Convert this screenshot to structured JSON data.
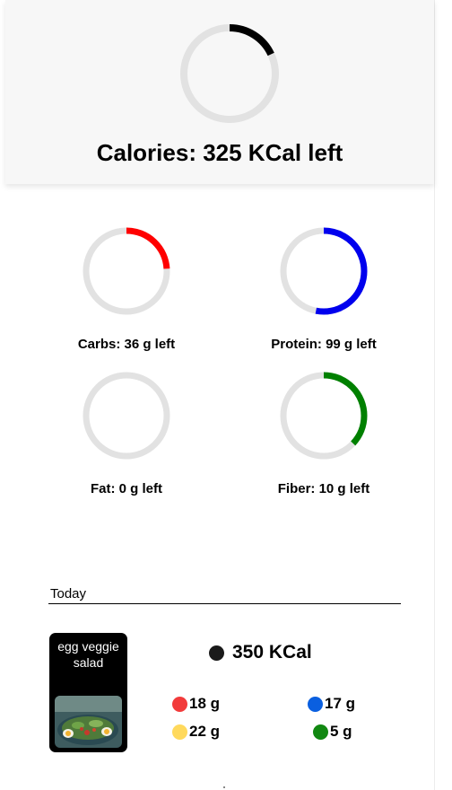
{
  "calories": {
    "label": "Calories: 325 KCal left",
    "progress": 0.18,
    "color": "#000000"
  },
  "macros": [
    {
      "id": "carbs",
      "label": "Carbs: 36 g left",
      "progress": 0.24,
      "color": "#ff0000"
    },
    {
      "id": "protein",
      "label": "Protein: 99 g left",
      "progress": 0.53,
      "color": "#0000ee"
    },
    {
      "id": "fat",
      "label": "Fat: 0 g left",
      "progress": 0.0,
      "color": "#ff0000"
    },
    {
      "id": "fiber",
      "label": "Fiber: 10 g left",
      "progress": 0.37,
      "color": "#008000"
    }
  ],
  "ring_track_color": "#e2e2e2",
  "today": {
    "label": "Today"
  },
  "meal": {
    "name": "egg veggie salad",
    "kcal": "350 KCal",
    "kcal_dot_color": "#1a1a1a",
    "nutrients": [
      {
        "id": "carbs",
        "value": "18 g",
        "color": "#f23b3b"
      },
      {
        "id": "protein",
        "value": "17 g",
        "color": "#0a5fe0"
      },
      {
        "id": "fat",
        "value": "22 g",
        "color": "#ffd95c"
      },
      {
        "id": "fiber",
        "value": "5 g",
        "color": "#118811"
      }
    ]
  }
}
